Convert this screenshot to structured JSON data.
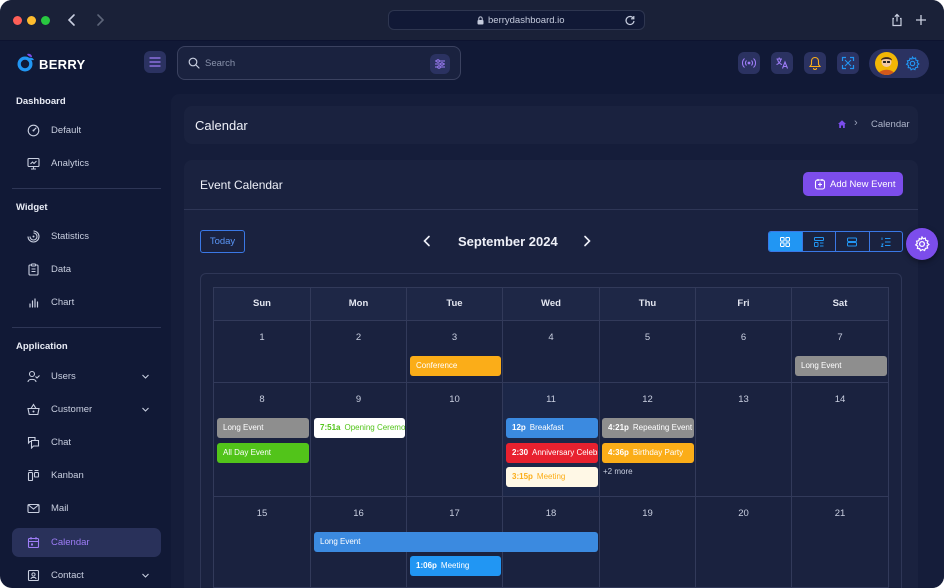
{
  "browser": {
    "url": "berrydashboard.io"
  },
  "brand": {
    "name": "BERRY"
  },
  "search": {
    "placeholder": "Search"
  },
  "sidebar": {
    "sections": [
      {
        "title": "Dashboard",
        "items": [
          {
            "label": "Default",
            "icon": "dashboard-icon"
          },
          {
            "label": "Analytics",
            "icon": "device-analytics-icon"
          }
        ]
      },
      {
        "title": "Widget",
        "items": [
          {
            "label": "Statistics",
            "icon": "chart-arcs-icon"
          },
          {
            "label": "Data",
            "icon": "clipboard-list-icon"
          },
          {
            "label": "Chart",
            "icon": "chart-bars-icon"
          }
        ]
      },
      {
        "title": "Application",
        "items": [
          {
            "label": "Users",
            "icon": "user-check-icon"
          },
          {
            "label": "Customer",
            "icon": "basket-icon"
          },
          {
            "label": "Chat",
            "icon": "messages-icon"
          },
          {
            "label": "Kanban",
            "icon": "layout-kanban-icon"
          },
          {
            "label": "Mail",
            "icon": "mail-icon"
          },
          {
            "label": "Calendar",
            "icon": "calendar-icon",
            "active": true
          },
          {
            "label": "Contact",
            "icon": "id-card-icon"
          }
        ]
      }
    ]
  },
  "page": {
    "title": "Calendar",
    "breadcrumb_current": "Calendar"
  },
  "calendar_card": {
    "title": "Event Calendar",
    "add_button": "Add New Event",
    "today_button": "Today",
    "month": "September 2024",
    "views": [
      "month",
      "week",
      "day",
      "agenda"
    ],
    "active_view": "month",
    "weekdays": [
      "Sun",
      "Mon",
      "Tue",
      "Wed",
      "Thu",
      "Fri",
      "Sat"
    ],
    "weeks": [
      [
        "1",
        "2",
        "3",
        "4",
        "5",
        "6",
        "7"
      ],
      [
        "8",
        "9",
        "10",
        "11",
        "12",
        "13",
        "14"
      ],
      [
        "15",
        "16",
        "17",
        "18",
        "19",
        "20",
        "21"
      ]
    ],
    "events": [
      {
        "title": "Conference",
        "time": "",
        "color": "#fbad18",
        "text": "#ffffff"
      },
      {
        "title": "Long Event",
        "time": "",
        "color": "#8e8e8e",
        "text": "#ffffff"
      },
      {
        "title": "Long Event",
        "time": "",
        "color": "#8e8e8e",
        "text": "#ffffff"
      },
      {
        "title": "All Day Event",
        "time": "",
        "color": "#52c41a",
        "text": "#ffffff"
      },
      {
        "title": "Opening Ceremony",
        "time": "7:51a",
        "color": "#ffffff",
        "text": "#52c41a"
      },
      {
        "title": "Breakfast",
        "time": "12p",
        "color": "#3b8ae0",
        "text": "#ffffff"
      },
      {
        "title": "Anniversary Celebration",
        "time": "2:30",
        "color": "#e8212f",
        "text": "#ffffff"
      },
      {
        "title": "Meeting",
        "time": "3:15p",
        "color": "#fff8e6",
        "text": "#fbad18"
      },
      {
        "title": "Repeating Event",
        "time": "4:21p",
        "color": "#8e8e8e",
        "text": "#ffffff"
      },
      {
        "title": "Birthday Party",
        "time": "4:36p",
        "color": "#fbad18",
        "text": "#ffffff"
      },
      {
        "title": "Long Event",
        "time": "",
        "color": "#3b8ae0",
        "text": "#ffffff"
      },
      {
        "title": "Meeting",
        "time": "1:06p",
        "color": "#2196f3",
        "text": "#ffffff"
      }
    ],
    "more_link": "+2 more"
  }
}
